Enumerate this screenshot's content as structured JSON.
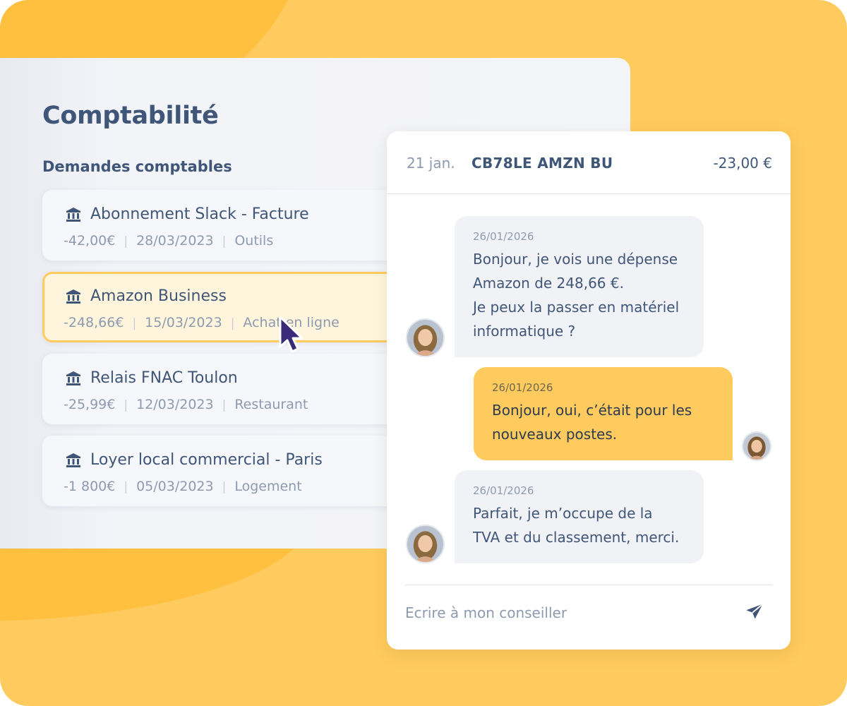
{
  "accounting": {
    "title": "Comptabilité",
    "section_title": "Demandes comptables",
    "requests": [
      {
        "name": "Abonnement Slack - Facture",
        "amount": "-42,00€",
        "date": "28/03/2023",
        "category": "Outils",
        "icon": "bank-icon",
        "selected": false
      },
      {
        "name": "Amazon Business",
        "amount": "-248,66€",
        "date": "15/03/2023",
        "category": "Achat en ligne",
        "icon": "bank-icon",
        "selected": true
      },
      {
        "name": "Relais FNAC Toulon",
        "amount": "-25,99€",
        "date": "12/03/2023",
        "category": "Restaurant",
        "icon": "bank-icon",
        "selected": false
      },
      {
        "name": "Loyer local commercial - Paris",
        "amount": "-1 800€",
        "date": "05/03/2023",
        "category": "Logement",
        "icon": "bank-icon",
        "selected": false
      }
    ]
  },
  "chat": {
    "header": {
      "date": "21 jan.",
      "label": "CB78LE AMZN BU",
      "amount": "-23,00 €"
    },
    "messages": [
      {
        "from": "advisor",
        "date": "26/01/2026",
        "lines": [
          "Bonjour, je vois une dépense",
          "Amazon de 248,66 €.",
          "Je peux la passer en matériel",
          "informatique ?"
        ]
      },
      {
        "from": "user",
        "date": "26/01/2026",
        "lines": [
          "Bonjour, oui, c’était pour les",
          "nouveaux postes."
        ]
      },
      {
        "from": "advisor",
        "date": "26/01/2026",
        "lines": [
          "Parfait, je m’occupe de la",
          "TVA et du classement, merci."
        ]
      }
    ],
    "composer": {
      "placeholder": "Ecrire à mon conseiller",
      "send_icon": "send-icon"
    }
  },
  "colors": {
    "background": "#ffcb5e",
    "accent": "#ffcb5e",
    "text_primary": "#3f5678",
    "text_muted": "#8d9ab0"
  }
}
